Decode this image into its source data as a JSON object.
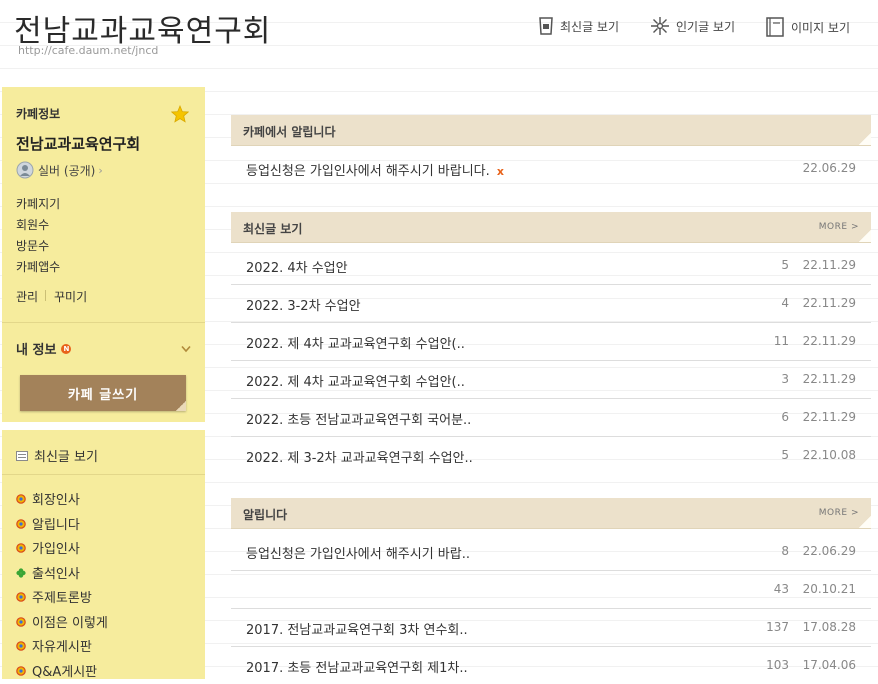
{
  "header": {
    "title": "전남교과교육연구회",
    "url": "http://cafe.daum.net/jncd",
    "nav": [
      {
        "label": "최신글 보기",
        "icon": "cup-icon"
      },
      {
        "label": "인기글 보기",
        "icon": "flower-icon"
      },
      {
        "label": "이미지 보기",
        "icon": "book-icon"
      }
    ]
  },
  "cafe_info": {
    "heading": "카페정보",
    "name": "전남교과교육연구회",
    "level": "실버 (공개)",
    "links": [
      "카페지기",
      "회원수",
      "방문수",
      "카페앱수"
    ],
    "manage": "관리",
    "decorate": "꾸미기",
    "my_info": "내 정보",
    "new_badge": "N",
    "write_button": "카페 글쓰기"
  },
  "boards": {
    "recent": "최신글 보기",
    "items": [
      "회장인사",
      "알립니다",
      "가입인사",
      "출석인사",
      "주제토론방",
      "이점은 이렇게",
      "자유게시판",
      "Q&A게시판"
    ]
  },
  "notice_section": {
    "title": "카페에서 알립니다",
    "row": {
      "title": "등업신청은 가입인사에서 해주시기 바랍니다.",
      "mark": "x",
      "date": "22.06.29"
    }
  },
  "recent_section": {
    "title": "최신글 보기",
    "more": "MORE >",
    "rows": [
      {
        "title": "2022. 4차 수업안",
        "count": "5",
        "date": "22.11.29"
      },
      {
        "title": "2022. 3-2차 수업안",
        "count": "4",
        "date": "22.11.29"
      },
      {
        "title": "2022. 제 4차 교과교육연구회 수업안(..",
        "count": "11",
        "date": "22.11.29"
      },
      {
        "title": "2022. 제 4차 교과교육연구회 수업안(..",
        "count": "3",
        "date": "22.11.29"
      },
      {
        "title": "2022. 초등 전남교과교육연구회 국어분..",
        "count": "6",
        "date": "22.11.29"
      },
      {
        "title": "2022. 제 3-2차 교과교육연구회 수업안..",
        "count": "5",
        "date": "22.10.08"
      }
    ]
  },
  "alarm_section": {
    "title": "알립니다",
    "more": "MORE >",
    "rows": [
      {
        "title": "등업신청은 가입인사에서 해주시기 바랍..",
        "count": "8",
        "date": "22.06.29"
      },
      {
        "title": "",
        "count": "43",
        "date": "20.10.21"
      },
      {
        "title": "2017. 전남교과교육연구회 3차 연수회..",
        "count": "137",
        "date": "17.08.28"
      },
      {
        "title": "2017. 초등 전남교과교육연구회 제1차..",
        "count": "103",
        "date": "17.04.06"
      }
    ]
  },
  "colors": {
    "sidebar": "#f6ec9d",
    "section_header": "#ece1cb",
    "button": "#a3825a",
    "accent": "#e8621a"
  }
}
